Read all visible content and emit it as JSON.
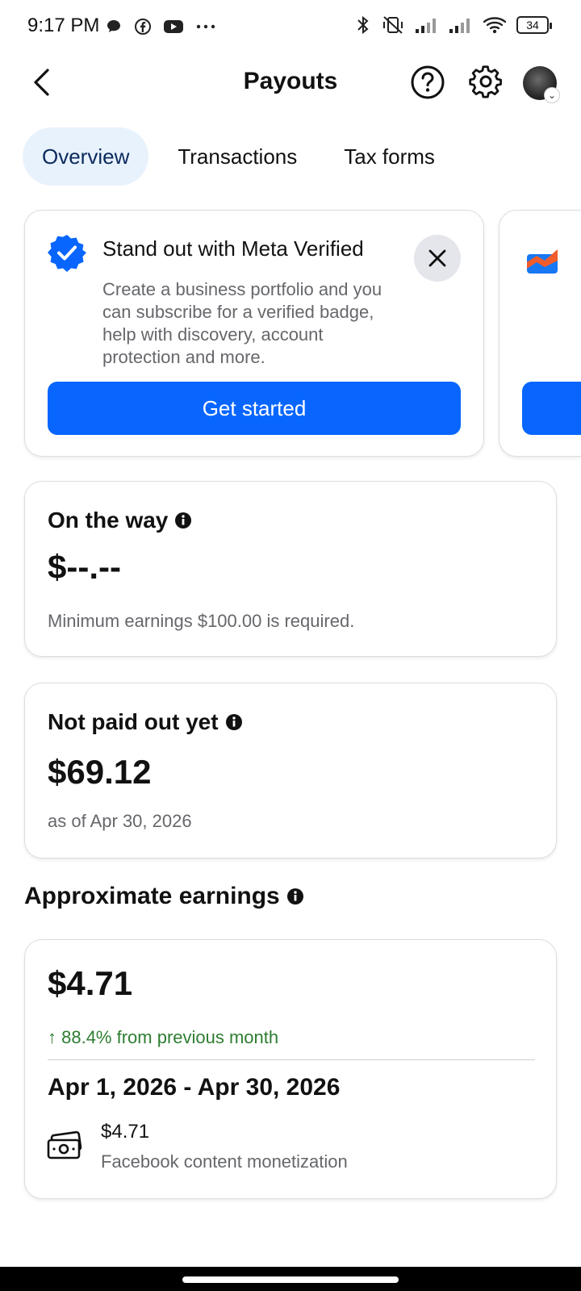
{
  "status_bar": {
    "time": "9:17 PM",
    "battery": "34",
    "left_icons": [
      "chat-bubble-icon",
      "facebook-icon",
      "youtube-icon",
      "more-dots-icon"
    ],
    "right_icons": [
      "bluetooth-icon",
      "vibrate-off-icon",
      "signal-icon",
      "signal-icon",
      "wifi-icon",
      "battery-icon"
    ]
  },
  "header": {
    "title": "Payouts"
  },
  "tabs": [
    {
      "label": "Overview",
      "active": true
    },
    {
      "label": "Transactions",
      "active": false
    },
    {
      "label": "Tax forms",
      "active": false
    }
  ],
  "promo": {
    "title": "Stand out with Meta Verified",
    "description": "Create a business portfolio and you can subscribe for a verified badge, help with discovery, account protection and more.",
    "cta": "Get started"
  },
  "on_the_way": {
    "heading": "On the way",
    "amount": "$--.--",
    "note": "Minimum earnings $100.00 is required."
  },
  "not_paid": {
    "heading": "Not paid out yet",
    "amount": "$69.12",
    "note": "as of Apr 30, 2026"
  },
  "approx": {
    "section_title": "Approximate earnings",
    "amount": "$4.71",
    "trend": "↑ 88.4% from previous month",
    "date_range": "Apr 1, 2026 - Apr 30, 2026",
    "breakdown_amount": "$4.71",
    "breakdown_label": "Facebook content monetization"
  },
  "colors": {
    "accent": "#0866ff",
    "tab_active_bg": "#e8f2fd",
    "trend_green": "#2e7d32",
    "muted_text": "#65676b"
  }
}
